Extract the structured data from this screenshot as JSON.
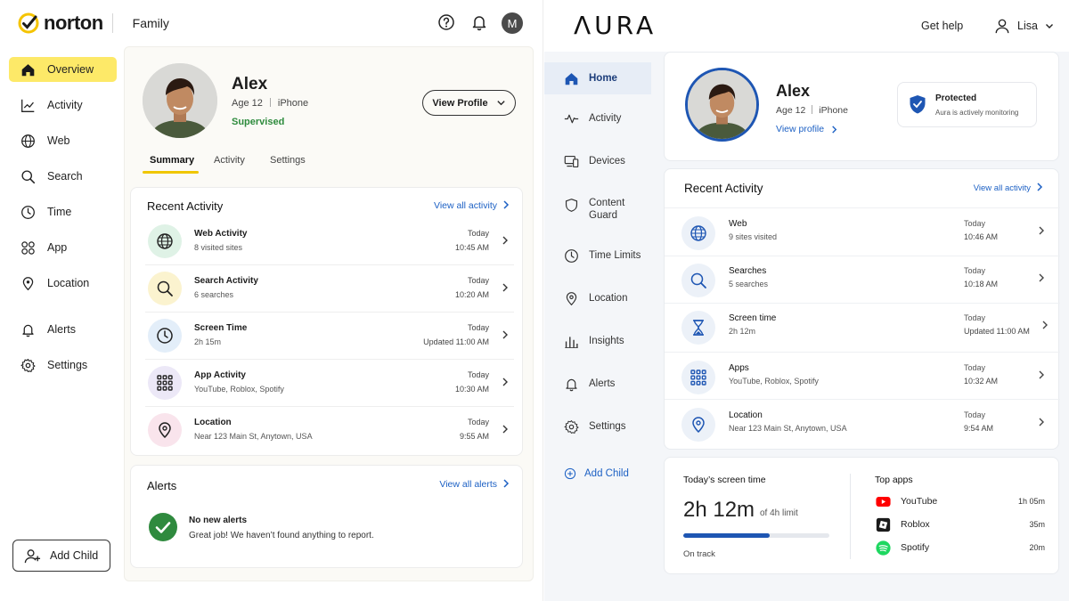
{
  "norton": {
    "logo_text": "norton",
    "product": "Family",
    "avatar_initial": "M",
    "nav": [
      {
        "label": "Overview",
        "icon": "home-icon",
        "active": true
      },
      {
        "label": "Activity",
        "icon": "activity-chart-icon"
      },
      {
        "label": "Web",
        "icon": "globe-icon"
      },
      {
        "label": "Search",
        "icon": "search-icon"
      },
      {
        "label": "Time",
        "icon": "clock-icon"
      },
      {
        "label": "App",
        "icon": "apps-icon"
      },
      {
        "label": "Location",
        "icon": "location-pin-icon"
      },
      {
        "label": "Alerts",
        "icon": "bell-icon"
      },
      {
        "label": "Settings",
        "icon": "gear-icon"
      }
    ],
    "add_child": "Add Child",
    "profile": {
      "name": "Alex",
      "age": "Age 12",
      "device": "iPhone",
      "status": "Supervised",
      "view_profile": "View Profile"
    },
    "tabs": [
      "Summary",
      "Activity",
      "Settings"
    ],
    "recent": {
      "title": "Recent Activity",
      "link": "View all activity",
      "rows": [
        {
          "title": "Web Activity",
          "sub": "8 visited sites",
          "day": "Today",
          "time": "10:45 AM",
          "icon": "globe-icon",
          "color": "#dff2e6"
        },
        {
          "title": "Search Activity",
          "sub": "6 searches",
          "day": "Today",
          "time": "10:20 AM",
          "icon": "search-icon",
          "color": "#fbf3cf"
        },
        {
          "title": "Screen Time",
          "sub": "2h 15m",
          "day": "Today",
          "time": "Updated 11:00 AM",
          "icon": "clock-icon",
          "color": "#e3eef9"
        },
        {
          "title": "App Activity",
          "sub": "YouTube, Roblox, Spotify",
          "day": "Today",
          "time": "10:30 AM",
          "icon": "apps-icon",
          "color": "#ece8f7"
        },
        {
          "title": "Location",
          "sub": "Near 123 Main St, Anytown, USA",
          "day": "Today",
          "time": "9:55 AM",
          "icon": "location-pin-icon",
          "color": "#f9e4ec"
        }
      ]
    },
    "alerts": {
      "title": "Alerts",
      "link": "View all alerts",
      "none_title": "No new alerts",
      "none_sub": "Great job! We haven’t found anything to report."
    },
    "colors": {
      "brand_yellow": "#fde968",
      "link_blue": "#1c60c4",
      "success_green": "#2f8a3e"
    }
  },
  "aura": {
    "logo": "ΛURA",
    "help": "Get help",
    "user": "Lisa",
    "nav": [
      {
        "label": "Home",
        "icon": "home-icon",
        "active": true
      },
      {
        "label": "Activity",
        "icon": "pulse-icon"
      },
      {
        "label": "Devices",
        "icon": "devices-icon"
      },
      {
        "label": "Content Guard",
        "icon": "shield-icon"
      },
      {
        "label": "Time Limits",
        "icon": "clock-icon"
      },
      {
        "label": "Location",
        "icon": "location-pin-icon"
      },
      {
        "label": "Insights",
        "icon": "bar-chart-icon"
      },
      {
        "label": "Alerts",
        "icon": "bell-icon"
      },
      {
        "label": "Settings",
        "icon": "gear-icon"
      }
    ],
    "add_child": "Add Child",
    "profile": {
      "name": "Alex",
      "age": "Age 12",
      "device": "iPhone",
      "view_profile": "View profile",
      "protected_title": "Protected",
      "protected_sub": "Aura is actively monitoring"
    },
    "recent": {
      "title": "Recent Activity",
      "link": "View all activity",
      "rows": [
        {
          "title": "Web",
          "sub": "9 sites visited",
          "day": "Today",
          "time": "10:46 AM",
          "icon": "globe-icon"
        },
        {
          "title": "Searches",
          "sub": "5 searches",
          "day": "Today",
          "time": "10:18 AM",
          "icon": "search-icon"
        },
        {
          "title": "Screen time",
          "sub": "2h 12m",
          "day": "Today",
          "time": "Updated 11:00 AM",
          "icon": "hourglass-icon"
        },
        {
          "title": "Apps",
          "sub": "YouTube, Roblox, Spotify",
          "day": "Today",
          "time": "10:32 AM",
          "icon": "apps-icon"
        },
        {
          "title": "Location",
          "sub": "Near 123 Main St, Anytown, USA",
          "day": "Today",
          "time": "9:54 AM",
          "icon": "location-pin-icon"
        }
      ]
    },
    "screen_time": {
      "title": "Today’s screen time",
      "value": "2h 12m",
      "limit": "of 4h limit",
      "progress_fraction": 0.59,
      "status": "On track"
    },
    "top_apps": {
      "title": "Top apps",
      "apps": [
        {
          "name": "YouTube",
          "duration": "1h 05m",
          "icon": "youtube-icon"
        },
        {
          "name": "Roblox",
          "duration": "35m",
          "icon": "roblox-icon"
        },
        {
          "name": "Spotify",
          "duration": "20m",
          "icon": "spotify-icon"
        }
      ]
    },
    "colors": {
      "accent_blue": "#1e56b3",
      "nav_active_bg": "#e7edf6",
      "youtube_red": "#ff0000",
      "spotify_green": "#1ed760"
    }
  }
}
